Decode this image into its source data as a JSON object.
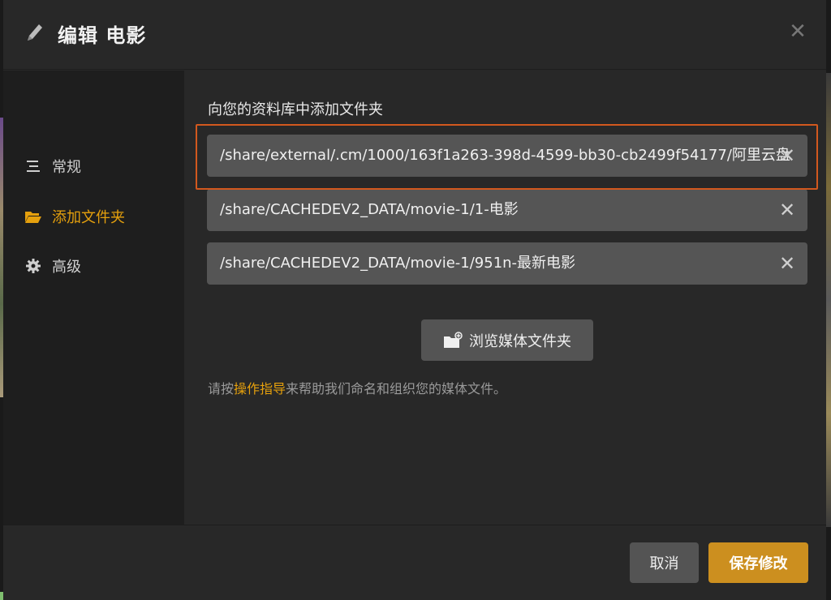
{
  "header": {
    "title": "编辑 电影",
    "icon": "pencil-icon",
    "close_label": "✕"
  },
  "sidebar": {
    "items": [
      {
        "label": "常规",
        "icon": "list-icon",
        "active": false
      },
      {
        "label": "添加文件夹",
        "icon": "folder-open-icon",
        "active": true
      },
      {
        "label": "高级",
        "icon": "gear-icon",
        "active": false
      }
    ]
  },
  "main": {
    "section_label": "向您的资料库中添加文件夹",
    "folders": [
      {
        "path": "/share/external/.cm/1000/163f1a263-398d-4599-bb30-cb2499f54177/阿里云盘"
      },
      {
        "path": "/share/CACHEDEV2_DATA/movie-1/1-电影"
      },
      {
        "path": "/share/CACHEDEV2_DATA/movie-1/951n-最新电影"
      }
    ],
    "remove_label": "✕",
    "browse_label": "浏览媒体文件夹",
    "help_prefix": "请按",
    "help_link": "操作指导",
    "help_suffix": "来帮助我们命名和组织您的媒体文件。"
  },
  "footer": {
    "cancel_label": "取消",
    "save_label": "保存修改"
  },
  "colors": {
    "accent": "#e5a00d",
    "save_button": "#cc8f1f",
    "highlight_border": "#d2581e"
  }
}
